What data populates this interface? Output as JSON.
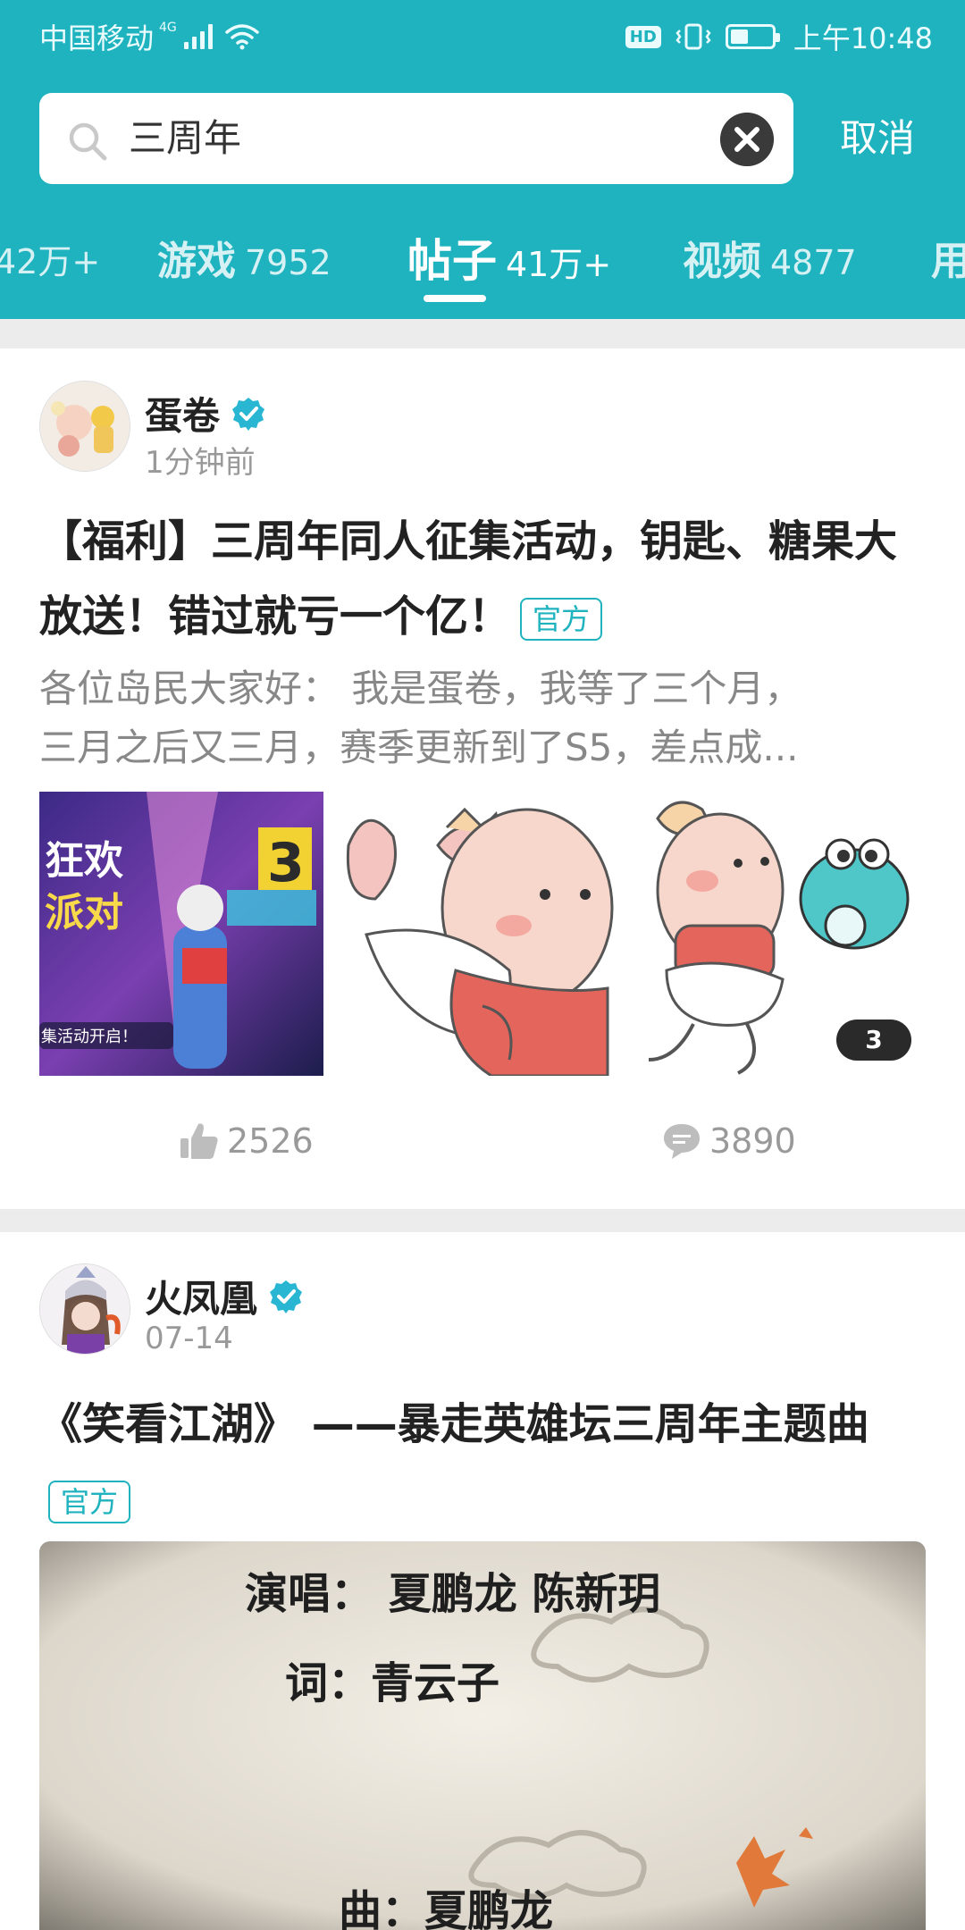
{
  "status_bar": {
    "carrier": "中国移动",
    "network": "4G",
    "hd_label": "HD",
    "time": "上午10:48"
  },
  "search": {
    "query": "三周年",
    "cancel_label": "取消"
  },
  "tabs": [
    {
      "label": "",
      "count": "42万+"
    },
    {
      "label": "游戏",
      "count": "7952"
    },
    {
      "label": "帖子",
      "count": "41万+",
      "active": true
    },
    {
      "label": "视频",
      "count": "4877"
    },
    {
      "label": "用",
      "count": ""
    }
  ],
  "posts": [
    {
      "author": "蛋卷",
      "time": "1分钟前",
      "title": "【福利】三周年同人征集活动，钥匙、糖果大放送！错过就亏一个亿！",
      "badge": "官方",
      "excerpt_line1": "各位岛民大家好： 我是蛋卷，我等了三个月，",
      "excerpt_line2": "三月之后又三月，赛季更新到了S5，差点成...",
      "image_texts": [
        "狂欢",
        "派对",
        "集活动开启！",
        "3"
      ],
      "extra_images_count": "3",
      "likes": "2526",
      "comments": "3890"
    },
    {
      "author": "火凤凰",
      "time": "07-14",
      "title": "《笑看江湖》 ——暴走英雄坛三周年主题曲",
      "badge": "官方",
      "video_credits": {
        "singers": "演唱： 夏鹏龙 陈新玥",
        "lyrics": "词：青云子",
        "music": "曲：夏鹏龙"
      }
    }
  ],
  "colors": {
    "header_teal": "#1fb3bf",
    "verify_blue": "#29b6d3",
    "badge_teal": "#1fb3bf"
  }
}
